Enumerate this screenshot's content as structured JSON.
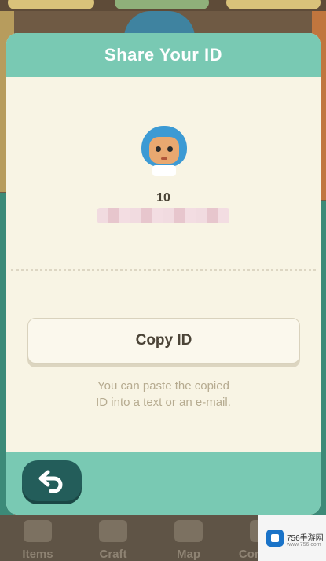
{
  "modal": {
    "title": "Share Your ID",
    "player_level": "10",
    "copy_button_label": "Copy ID",
    "hint_line1": "You can paste the copied",
    "hint_line2": "ID into a text or an e-mail.",
    "back_icon": "back-arrow-icon"
  },
  "bottom_nav": {
    "items": [
      {
        "label": "Items",
        "icon": "bag-icon"
      },
      {
        "label": "Craft",
        "icon": "hammer-icon"
      },
      {
        "label": "Map",
        "icon": "map-icon"
      },
      {
        "label": "Contacts",
        "icon": "cat-icon"
      }
    ]
  },
  "watermark": {
    "text": "756手游网",
    "sub": "www.756.com"
  },
  "colors": {
    "header": "#79c9b3",
    "modal_bg": "#f8f4e4",
    "back_button": "#235d5a"
  }
}
